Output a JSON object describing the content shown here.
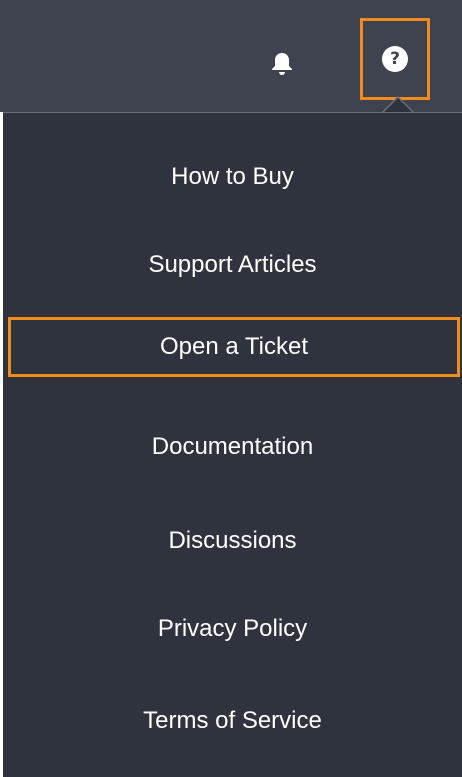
{
  "header": {
    "bell_icon": "bell-icon",
    "help_icon": "question-circle-icon",
    "help_glyph": "?",
    "highlight_color": "#f08c1a"
  },
  "menu": {
    "items": [
      {
        "label": "How to Buy"
      },
      {
        "label": "Support Articles"
      },
      {
        "label": "Open a Ticket"
      },
      {
        "label": "Documentation"
      },
      {
        "label": "Discussions"
      },
      {
        "label": "Privacy Policy"
      },
      {
        "label": "Terms of Service"
      }
    ]
  }
}
